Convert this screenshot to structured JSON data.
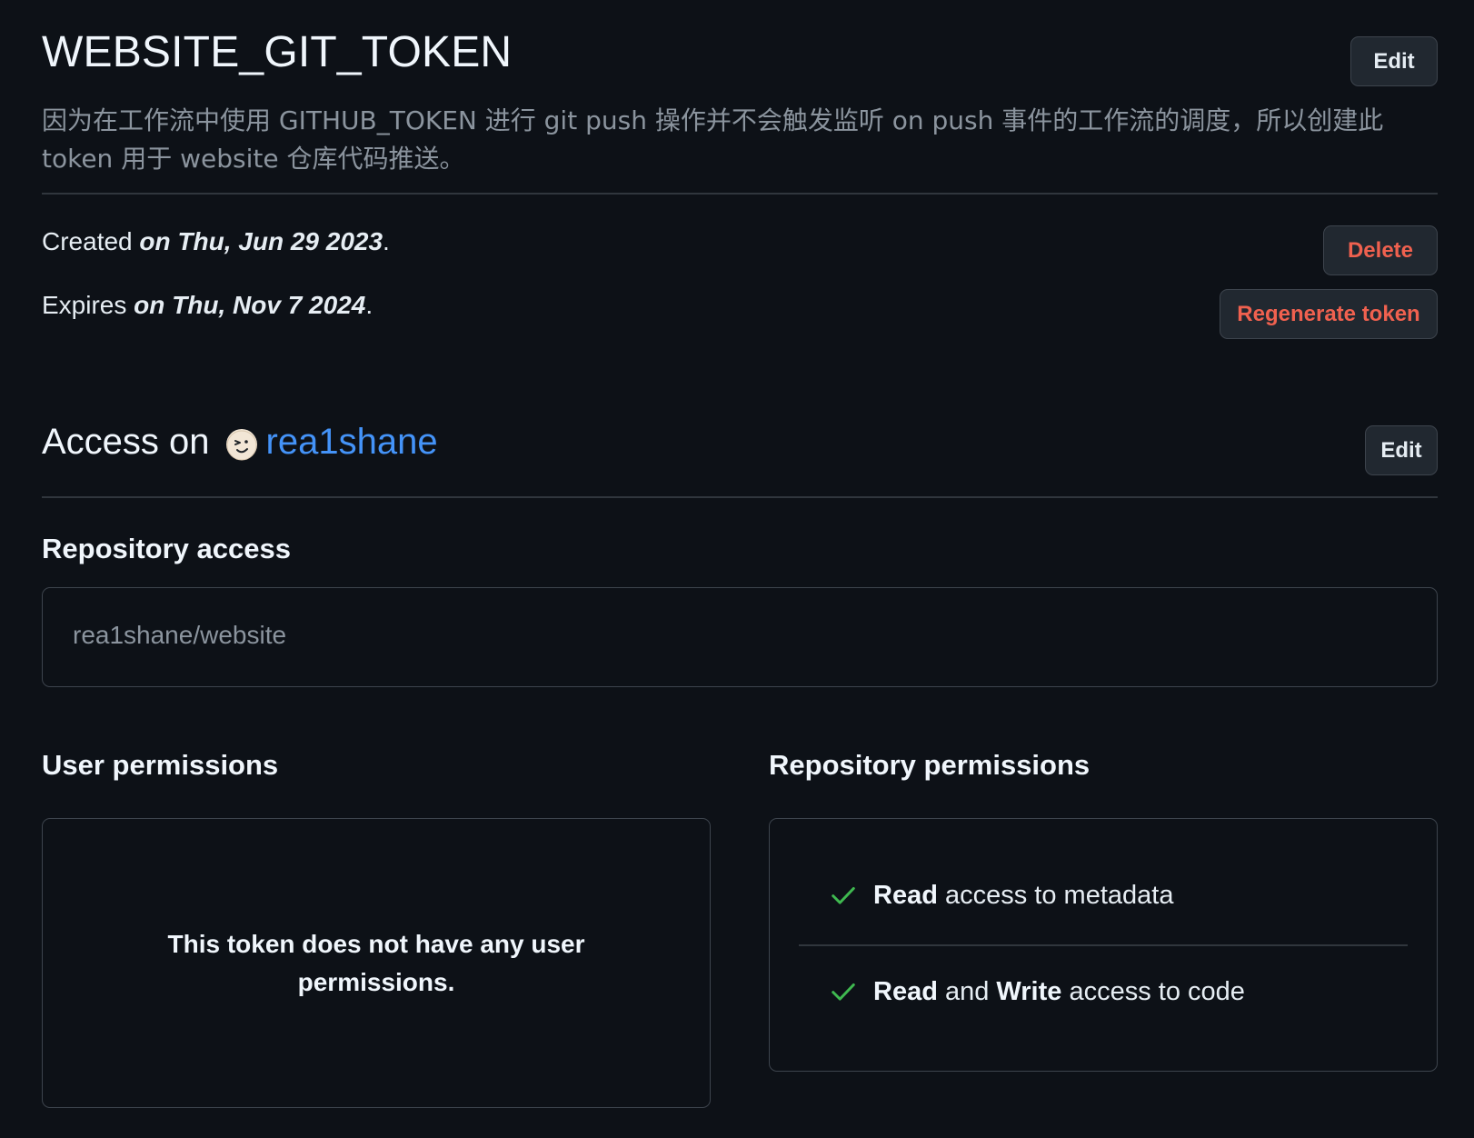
{
  "token": {
    "name": "WEBSITE_GIT_TOKEN",
    "edit_label": "Edit",
    "description": "因为在工作流中使用 GITHUB_TOKEN 进行 git push 操作并不会触发监听 on push 事件的工作流的调度，所以创建此 token 用于 website 仓库代码推送。"
  },
  "meta": {
    "created_prefix": "Created ",
    "created_date": "on Thu, Jun 29 2023",
    "expires_prefix": "Expires ",
    "expires_date": "on Thu, Nov 7 2024",
    "period": ".",
    "delete_label": "Delete",
    "regenerate_label": "Regenerate token"
  },
  "access": {
    "prefix": "Access on",
    "owner": "rea1shane",
    "edit_label": "Edit"
  },
  "repository_access": {
    "heading": "Repository access",
    "repositories": [
      "rea1shane/website"
    ]
  },
  "user_permissions": {
    "heading": "User permissions",
    "empty_message": "This token does not have any user permissions."
  },
  "repository_permissions": {
    "heading": "Repository permissions",
    "items": [
      {
        "level_1": "Read",
        "joiner": "",
        "level_2": "",
        "rest": " access to metadata"
      },
      {
        "level_1": "Read",
        "joiner": " and ",
        "level_2": "Write",
        "rest": " access to code"
      }
    ]
  },
  "colors": {
    "background": "#0d1117",
    "danger": "#f0614f",
    "link": "#4493f8",
    "check": "#3fb950"
  },
  "icons": {
    "check": "check-icon",
    "avatar": "avatar"
  }
}
